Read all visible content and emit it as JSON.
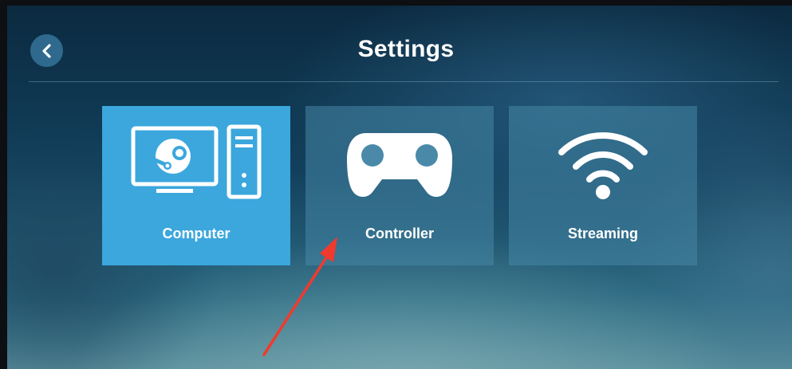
{
  "header": {
    "title": "Settings",
    "back_icon": "chevron-left-icon"
  },
  "tiles": [
    {
      "label": "Computer",
      "icon": "computer-steam-icon",
      "selected": true
    },
    {
      "label": "Controller",
      "icon": "gamepad-icon",
      "selected": false
    },
    {
      "label": "Streaming",
      "icon": "wifi-icon",
      "selected": false
    }
  ],
  "colors": {
    "selected_tile": "#3ba7dd",
    "tile": "#4687a5",
    "annotation_arrow": "#f03a2e"
  }
}
